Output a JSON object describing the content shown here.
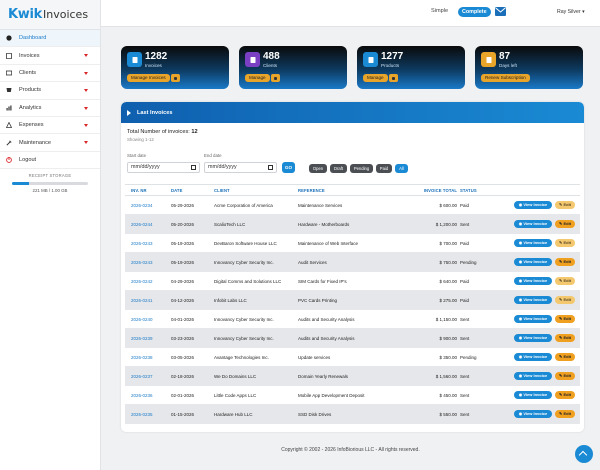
{
  "app": {
    "logo_bold": "Kwik",
    "logo_rest": "Invoices"
  },
  "sidebar": {
    "items": [
      {
        "label": "Dashboard",
        "icon": "dashboard-icon",
        "has_arrow": false
      },
      {
        "label": "Invoices",
        "icon": "invoice-icon",
        "has_arrow": true
      },
      {
        "label": "Clients",
        "icon": "clients-icon",
        "has_arrow": true
      },
      {
        "label": "Products",
        "icon": "products-icon",
        "has_arrow": true
      },
      {
        "label": "Analytics",
        "icon": "analytics-icon",
        "has_arrow": true
      },
      {
        "label": "Expenses",
        "icon": "expenses-icon",
        "has_arrow": true
      },
      {
        "label": "Maintenance",
        "icon": "maintenance-icon",
        "has_arrow": true
      },
      {
        "label": "Logout",
        "icon": "logout-icon",
        "has_arrow": false
      }
    ],
    "storage": {
      "label": "RECEIPT STORAGE",
      "value": "221 MB / 1.00 GB",
      "used_fraction": 0.221
    }
  },
  "topbar": {
    "mode_simple": "Simple",
    "mode_complete": "Complete",
    "user": "Ray Silver"
  },
  "cards": [
    {
      "count": "1282",
      "label": "Invoices",
      "button": "Manage Invoices",
      "icon": "invoice-card-icon",
      "icon_color": "#1a8ad4"
    },
    {
      "count": "488",
      "label": "Clients",
      "button": "Manage",
      "icon": "clients-card-icon",
      "icon_color": "#7b3fc4"
    },
    {
      "count": "1277",
      "label": "Products",
      "button": "Manage",
      "icon": "products-card-icon",
      "icon_color": "#1a8ad4"
    },
    {
      "count": "87",
      "label": "Days left",
      "button": "Renew Subscription",
      "icon": "calendar-card-icon",
      "icon_color": "#e9a42a"
    }
  ],
  "panel": {
    "title": "Last Invoices",
    "total_label": "Total Number of invoices:",
    "total_value": "12",
    "showing": "Showing 1-12",
    "start_label": "Start date",
    "end_label": "End date",
    "date_placeholder": "mm/dd/yyyy",
    "go": "GO",
    "filters": [
      "Open",
      "Draft",
      "Pending",
      "Paid",
      "All"
    ],
    "selected_filter": "All"
  },
  "table": {
    "columns": [
      "INV. NR",
      "DATE",
      "CLIENT",
      "REFERENCE",
      "INVOICE TOTAL",
      "STATUS"
    ],
    "view_label": "View Invoice",
    "edit_label": "Edit",
    "rows": [
      {
        "nr": "2026-0234",
        "date": "05-29-2026",
        "client": "Acme Corporation of America",
        "ref": "Maintenance Services",
        "total": "$ 600.00",
        "status": "Paid",
        "edit_disabled": true
      },
      {
        "nr": "2026-0244",
        "date": "05-20-2026",
        "client": "ScalioTech LLC",
        "ref": "Hardware - Motherboards",
        "total": "$ 1,200.00",
        "status": "Sent",
        "edit_disabled": false
      },
      {
        "nr": "2026-0243",
        "date": "05-19-2026",
        "client": "DevBaron Software House LLC",
        "ref": "Maintenance of Web Interface",
        "total": "$ 700.00",
        "status": "Paid",
        "edit_disabled": true
      },
      {
        "nr": "2026-0243",
        "date": "05-19-2026",
        "client": "Innovancy Cyber Security Inc.",
        "ref": "Audit Services",
        "total": "$ 750.00",
        "status": "Pending",
        "edit_disabled": false
      },
      {
        "nr": "2026-0242",
        "date": "04-29-2026",
        "client": "Digital Comms and Solutions LLC",
        "ref": "SIM Cards for Fixed IP's",
        "total": "$ 640.00",
        "status": "Paid",
        "edit_disabled": true
      },
      {
        "nr": "2026-0241",
        "date": "04-12-2026",
        "client": "Infobit Labs LLC",
        "ref": "PVC Cards Printing",
        "total": "$ 275.00",
        "status": "Paid",
        "edit_disabled": true
      },
      {
        "nr": "2026-0240",
        "date": "04-01-2026",
        "client": "Innovancy Cyber Security Inc.",
        "ref": "Audits and Security Analysis",
        "total": "$ 1,150.00",
        "status": "Sent",
        "edit_disabled": false
      },
      {
        "nr": "2026-0239",
        "date": "03-23-2026",
        "client": "Innovancy Cyber Security Inc.",
        "ref": "Audits and Security Analysis",
        "total": "$ 900.00",
        "status": "Sent",
        "edit_disabled": false
      },
      {
        "nr": "2026-0238",
        "date": "03-05-2026",
        "client": "Avantage Technologies Inc.",
        "ref": "Update services",
        "total": "$ 350.00",
        "status": "Pending",
        "edit_disabled": false
      },
      {
        "nr": "2026-0237",
        "date": "02-18-2026",
        "client": "We Do Domains LLC",
        "ref": "Domain Yearly Renewals",
        "total": "$ 1,560.00",
        "status": "Sent",
        "edit_disabled": false
      },
      {
        "nr": "2026-0236",
        "date": "02-01-2026",
        "client": "Little Code Apps LLC",
        "ref": "Mobile App Development Deposit",
        "total": "$ 450.00",
        "status": "Sent",
        "edit_disabled": false
      },
      {
        "nr": "2026-0235",
        "date": "01-15-2026",
        "client": "Hardware Hub LLC",
        "ref": "SSD Disk Drives",
        "total": "$ 550.00",
        "status": "Sent",
        "edit_disabled": false
      }
    ]
  },
  "footer": "Copyright © 2002 - 2026 InfoBiorious LLC - All rights reserved."
}
